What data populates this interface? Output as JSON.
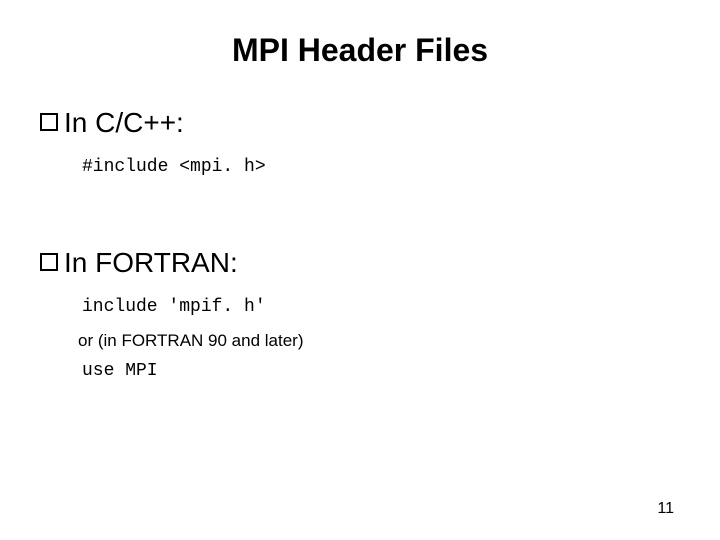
{
  "title": "MPI Header Files",
  "section_c": {
    "heading": "In C/C++:",
    "code": "#include <mpi. h>"
  },
  "section_fortran": {
    "heading": "In FORTRAN:",
    "code1": "include 'mpif. h'",
    "note": "or (in FORTRAN 90 and later)",
    "code2": "use MPI"
  },
  "page_number": "11"
}
